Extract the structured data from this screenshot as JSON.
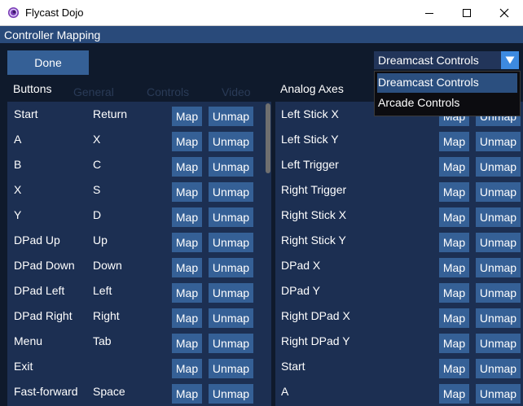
{
  "window": {
    "title": "Flycast Dojo"
  },
  "header": {
    "title": "Controller Mapping"
  },
  "toolbar": {
    "done_label": "Done"
  },
  "profile": {
    "selected": "Dreamcast Controls",
    "options": [
      "Dreamcast Controls",
      "Arcade Controls"
    ]
  },
  "buttons_section": {
    "title": "Buttons",
    "rows": [
      {
        "name": "Start",
        "key": "Return"
      },
      {
        "name": "A",
        "key": "X"
      },
      {
        "name": "B",
        "key": "C"
      },
      {
        "name": "X",
        "key": "S"
      },
      {
        "name": "Y",
        "key": "D"
      },
      {
        "name": "DPad Up",
        "key": "Up"
      },
      {
        "name": "DPad Down",
        "key": "Down"
      },
      {
        "name": "DPad Left",
        "key": "Left"
      },
      {
        "name": "DPad Right",
        "key": "Right"
      },
      {
        "name": "Menu",
        "key": "Tab"
      },
      {
        "name": "Exit",
        "key": ""
      },
      {
        "name": "Fast-forward",
        "key": "Space"
      }
    ]
  },
  "axes_section": {
    "title": "Analog Axes",
    "rows": [
      {
        "name": "Left Stick X",
        "key": ""
      },
      {
        "name": "Left Stick Y",
        "key": ""
      },
      {
        "name": "Left Trigger",
        "key": ""
      },
      {
        "name": "Right Trigger",
        "key": ""
      },
      {
        "name": "Right Stick X",
        "key": ""
      },
      {
        "name": "Right Stick Y",
        "key": ""
      },
      {
        "name": "DPad X",
        "key": ""
      },
      {
        "name": "DPad Y",
        "key": ""
      },
      {
        "name": "Right DPad X",
        "key": ""
      },
      {
        "name": "Right DPad Y",
        "key": ""
      },
      {
        "name": "Start",
        "key": ""
      },
      {
        "name": "A",
        "key": ""
      }
    ]
  },
  "labels": {
    "map": "Map",
    "unmap": "Unmap"
  },
  "background_tabs": [
    "General",
    "Controls",
    "Video"
  ],
  "colors": {
    "accent": "#3d8ae0",
    "button": "#356096",
    "header": "#294a7a",
    "panel": "#1c2f52"
  },
  "icons": {
    "app": "flycast-swirl-icon",
    "combo": "triangle-down-icon"
  }
}
